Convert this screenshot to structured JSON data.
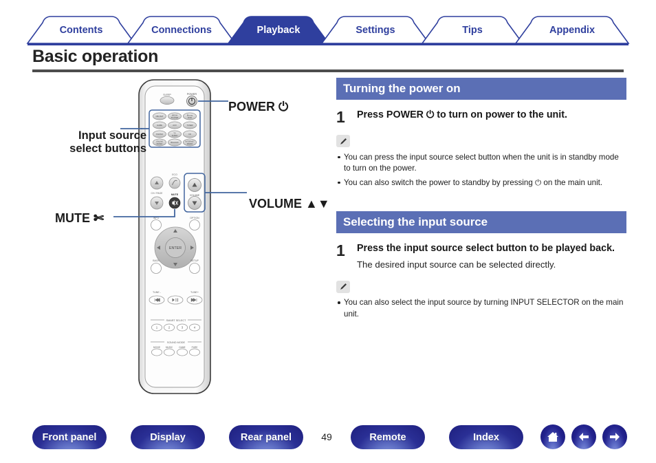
{
  "tabs": [
    {
      "label": "Contents",
      "active": false
    },
    {
      "label": "Connections",
      "active": false
    },
    {
      "label": "Playback",
      "active": true
    },
    {
      "label": "Settings",
      "active": false
    },
    {
      "label": "Tips",
      "active": false
    },
    {
      "label": "Appendix",
      "active": false
    }
  ],
  "page": {
    "title": "Basic operation",
    "number": "49"
  },
  "callouts": {
    "input_source": "Input source select buttons",
    "power": "POWER ⏻",
    "volume": "VOLUME ▲▼",
    "mute": "MUTE ✄"
  },
  "remote": {
    "sleep_label": "SLEEP",
    "power_label": "POWER",
    "input_buttons": [
      "CBL/SAT",
      "MEDIA PLAYER",
      "Blu-ray DVD",
      "GAME",
      "AUX",
      "TUNER",
      "PHONO",
      "TV AUDIO",
      "CD",
      "ONLINE MUSIC",
      "Bluetooth",
      "INTERNET RADIO"
    ],
    "ch_page_label": "CH / PAGE",
    "eco_label": "ECO",
    "mute_label": "MUTE",
    "volume_label": "VOLUME",
    "info_label": "INFO",
    "option_label": "OPTION",
    "enter_label": "ENTER",
    "back_label": "BACK",
    "setup_label": "SETUP",
    "tune_minus_label": "TUNE -",
    "tune_plus_label": "TUNE+",
    "smart_select_label": "SMART SELECT",
    "smart_select_numbers": [
      "1",
      "2",
      "3",
      "4"
    ],
    "sound_mode_label": "SOUND MODE",
    "sound_modes": [
      "MOVIE",
      "MUSIC",
      "GAME",
      "PURE"
    ]
  },
  "sections": [
    {
      "header": "Turning the power on",
      "step_number": "1",
      "step_title": "Press POWER ⏻ to turn on power to the unit.",
      "step_sub": "",
      "notes": [
        "You can press the input source select button when the unit is in standby mode to turn on the power.",
        "You can also switch the power to standby by pressing ⏻ on the main unit."
      ]
    },
    {
      "header": "Selecting the input source",
      "step_number": "1",
      "step_title": "Press the input source select button to be played back.",
      "step_sub": "The desired input source can be selected directly.",
      "notes": [
        "You can also select the input source by turning INPUT SELECTOR on the main unit."
      ]
    }
  ],
  "bottom_nav": {
    "pills": [
      {
        "label": "Front panel"
      },
      {
        "label": "Display"
      },
      {
        "label": "Rear panel"
      },
      {
        "label": "Remote"
      },
      {
        "label": "Index"
      }
    ],
    "icons": [
      {
        "name": "home-icon"
      },
      {
        "name": "back-arrow-icon"
      },
      {
        "name": "forward-arrow-icon"
      }
    ]
  },
  "colors": {
    "tab_active": "#2f3f9e",
    "tab_text": "#2f3f9e",
    "section_header": "#5b6fb5",
    "rule": "#4d4d4d",
    "callout_line": "#41659e"
  }
}
